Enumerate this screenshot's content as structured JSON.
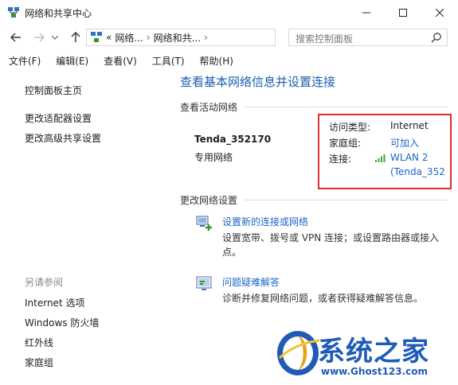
{
  "window": {
    "title": "网络和共享中心"
  },
  "address_bar": {
    "chevron": "«",
    "segment1": "网络...",
    "segment2": "网络和共...",
    "search_placeholder": "搜索控制面板"
  },
  "menu": [
    "文件(F)",
    "编辑(E)",
    "查看(V)",
    "工具(T)",
    "帮助(H)"
  ],
  "sidebar": {
    "links": [
      "控制面板主页",
      "更改适配器设置",
      "更改高级共享设置"
    ],
    "see_also_header": "另请参阅",
    "see_also": [
      "Internet 选项",
      "Windows 防火墙",
      "红外线",
      "家庭组"
    ]
  },
  "main": {
    "title": "查看基本网络信息并设置连接",
    "active_networks_label": "查看活动网络",
    "network": {
      "name": "Tenda_352170",
      "type": "专用网络",
      "access_type_label": "访问类型:",
      "access_type_value": "Internet",
      "homegroup_label": "家庭组:",
      "homegroup_value": "可加入",
      "connection_label": "连接:",
      "connection_value_line1": "WLAN 2",
      "connection_value_line2": "(Tenda_352"
    },
    "change_settings_label": "更改网络设置",
    "settings": [
      {
        "link": "设置新的连接或网络",
        "desc_line1": "设置宽带、拨号或 VPN 连接；或设置路由器或接入",
        "desc_line2": "点。"
      },
      {
        "link": "问题疑难解答",
        "desc_line1": "诊断并修复网络问题，或者获得疑难解答信息。"
      }
    ]
  },
  "watermark": {
    "name": "系统之家",
    "url": "www.Ghost123.com"
  },
  "colors": {
    "link": "#1a66c9",
    "highlight_box": "#e02d2d",
    "title": "#1a5fb4"
  }
}
